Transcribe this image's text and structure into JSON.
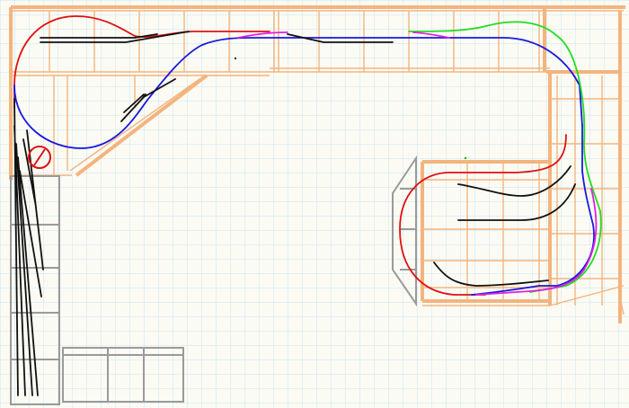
{
  "colors": {
    "grid": "#bfe0ee",
    "benchwork": "#f4b47e",
    "structure": "#9a9a9a",
    "track_red": "#e01010",
    "track_blue": "#1818e0",
    "track_green": "#22dd22",
    "track_magenta": "#e020e0",
    "track_black": "#111111"
  },
  "icons": {
    "turntable": "turntable-icon"
  }
}
